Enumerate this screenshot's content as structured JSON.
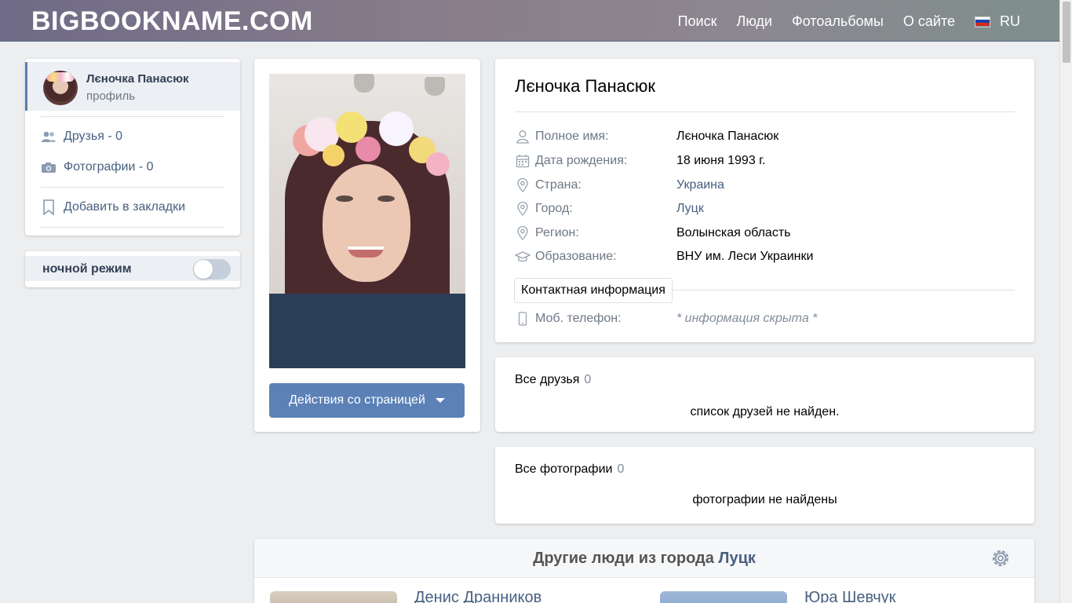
{
  "header": {
    "logo": "BIGBOOKNAME.COM",
    "nav": [
      "Поиск",
      "Люди",
      "Фотоальбомы",
      "О сайте"
    ],
    "lang": "RU",
    "flag_colors": [
      "#ffffff",
      "#1c3fa8",
      "#d52b1e"
    ]
  },
  "menu": {
    "name": "Лєночка Панасюк",
    "sub": "профиль",
    "friends": "Друзья - 0",
    "photos": "Фотографии - 0",
    "bookmark": "Добавить в закладки"
  },
  "night": {
    "label": "ночной режим",
    "enabled": false
  },
  "photo_card": {
    "actions_label": "Действия со страницей"
  },
  "info": {
    "title": "Лєночка Панасюк",
    "rows": [
      {
        "icon": "user-icon",
        "label": "Полное имя:",
        "value": "Лєночка Панасюк"
      },
      {
        "icon": "calendar-icon",
        "label": "Дата рождения:",
        "value": "18 июня 1993 г."
      },
      {
        "icon": "location-icon",
        "label": "Страна:",
        "value": "Украина"
      },
      {
        "icon": "location-icon",
        "label": "Город:",
        "value": "Луцк"
      },
      {
        "icon": "location-icon",
        "label": "Регион:",
        "value": "Волынская область"
      },
      {
        "icon": "graduation-cap-icon",
        "label": "Образование:",
        "value": "ВНУ им. Леси Украинки"
      }
    ],
    "contact_tab": "Контактная информация",
    "phone": {
      "icon": "mobile-phone-icon",
      "label": "Моб. телефон:",
      "value": "* информация скрыта *"
    }
  },
  "friends_box": {
    "title": "Все друзья",
    "count": "0",
    "empty": "список друзей не найден."
  },
  "photos_box": {
    "title": "Все фотографии",
    "count": "0",
    "empty": "фотографии не найдены"
  },
  "others": {
    "title_prefix": "Другие люди из города",
    "city": "Луцк",
    "people": [
      "Денис Дранников",
      "Юра Шевчук"
    ]
  },
  "colors": {
    "accent": "#5b81b7",
    "link": "#476080",
    "background": "#edeef0"
  }
}
